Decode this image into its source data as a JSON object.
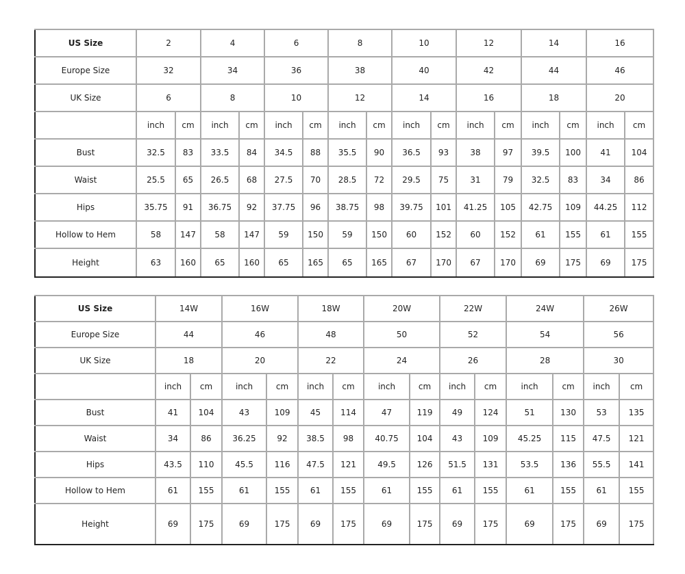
{
  "tables": [
    {
      "us_size_label": "US Size",
      "sizes": [
        "2",
        "4",
        "6",
        "8",
        "10",
        "12",
        "14",
        "16"
      ],
      "europe_label": "Europe Size",
      "europe": [
        "32",
        "34",
        "36",
        "38",
        "40",
        "42",
        "44",
        "46"
      ],
      "uk_label": "UK Size",
      "uk": [
        "6",
        "8",
        "10",
        "12",
        "14",
        "16",
        "18",
        "20"
      ],
      "unit_inch": "inch",
      "unit_cm": "cm",
      "rows": [
        {
          "label": "Bust",
          "values": [
            "32.5",
            "83",
            "33.5",
            "84",
            "34.5",
            "88",
            "35.5",
            "90",
            "36.5",
            "93",
            "38",
            "97",
            "39.5",
            "100",
            "41",
            "104"
          ]
        },
        {
          "label": "Waist",
          "values": [
            "25.5",
            "65",
            "26.5",
            "68",
            "27.5",
            "70",
            "28.5",
            "72",
            "29.5",
            "75",
            "31",
            "79",
            "32.5",
            "83",
            "34",
            "86"
          ]
        },
        {
          "label": "Hips",
          "values": [
            "35.75",
            "91",
            "36.75",
            "92",
            "37.75",
            "96",
            "38.75",
            "98",
            "39.75",
            "101",
            "41.25",
            "105",
            "42.75",
            "109",
            "44.25",
            "112"
          ]
        },
        {
          "label": "Hollow to Hem",
          "values": [
            "58",
            "147",
            "58",
            "147",
            "59",
            "150",
            "59",
            "150",
            "60",
            "152",
            "60",
            "152",
            "61",
            "155",
            "61",
            "155"
          ]
        },
        {
          "label": "Height",
          "values": [
            "63",
            "160",
            "65",
            "160",
            "65",
            "165",
            "65",
            "165",
            "67",
            "170",
            "67",
            "170",
            "69",
            "175",
            "69",
            "175"
          ]
        }
      ]
    },
    {
      "us_size_label": "US Size",
      "sizes": [
        "14W",
        "16W",
        "18W",
        "20W",
        "22W",
        "24W",
        "26W"
      ],
      "europe_label": "Europe Size",
      "europe": [
        "44",
        "46",
        "48",
        "50",
        "52",
        "54",
        "56"
      ],
      "uk_label": "UK Size",
      "uk": [
        "18",
        "20",
        "22",
        "24",
        "26",
        "28",
        "30"
      ],
      "unit_inch": "inch",
      "unit_cm": "cm",
      "rows": [
        {
          "label": "Bust",
          "values": [
            "41",
            "104",
            "43",
            "109",
            "45",
            "114",
            "47",
            "119",
            "49",
            "124",
            "51",
            "130",
            "53",
            "135"
          ]
        },
        {
          "label": "Waist",
          "values": [
            "34",
            "86",
            "36.25",
            "92",
            "38.5",
            "98",
            "40.75",
            "104",
            "43",
            "109",
            "45.25",
            "115",
            "47.5",
            "121"
          ]
        },
        {
          "label": "Hips",
          "values": [
            "43.5",
            "110",
            "45.5",
            "116",
            "47.5",
            "121",
            "49.5",
            "126",
            "51.5",
            "131",
            "53.5",
            "136",
            "55.5",
            "141"
          ]
        },
        {
          "label": "Hollow to Hem",
          "values": [
            "61",
            "155",
            "61",
            "155",
            "61",
            "155",
            "61",
            "155",
            "61",
            "155",
            "61",
            "155",
            "61",
            "155"
          ]
        },
        {
          "label": "Height",
          "values": [
            "69",
            "175",
            "69",
            "175",
            "69",
            "175",
            "69",
            "175",
            "69",
            "175",
            "69",
            "175",
            "69",
            "175"
          ]
        }
      ]
    }
  ]
}
